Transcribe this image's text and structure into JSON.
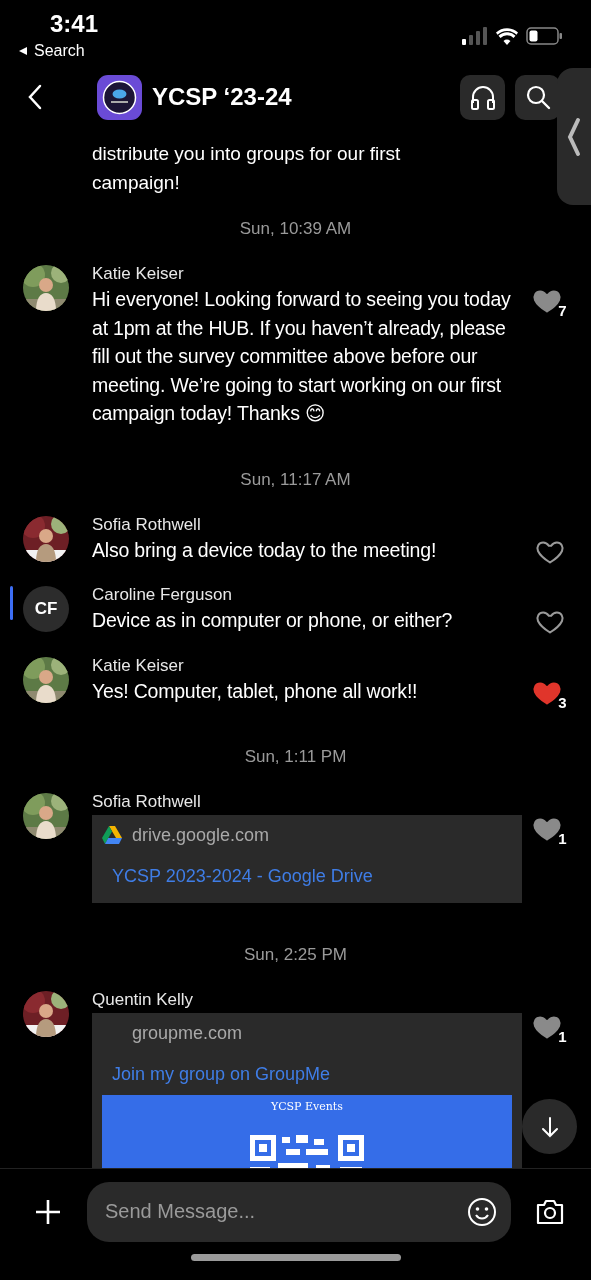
{
  "status_bar": {
    "time": "3:41",
    "back_label": "Search"
  },
  "header": {
    "title": "YCSP ‘23-24"
  },
  "feed": [
    {
      "kind": "continuation",
      "text": "distribute you into groups for our first campaign!"
    },
    {
      "kind": "time",
      "text": "Sun, 10:39 AM"
    },
    {
      "kind": "message",
      "author": "Katie Keiser",
      "text": "Hi everyone! Looking forward to seeing you today at 1pm at the HUB. If you haven’t already, please fill out the survey committee above before our meeting. We’re going to start working on our first campaign today! Thanks 😊",
      "likes": "7",
      "liked": false,
      "highlighted": false
    },
    {
      "kind": "time",
      "text": "Sun, 11:17 AM"
    },
    {
      "kind": "message",
      "author": "Sofia Rothwell",
      "text": "Also bring a device today to the meeting!",
      "liked": false,
      "highlighted": false
    },
    {
      "kind": "message",
      "author": "Caroline Ferguson",
      "initials": "CF",
      "text": "Device as in computer or phone, or either?",
      "liked": false,
      "highlighted": true
    },
    {
      "kind": "message",
      "author": "Katie Keiser",
      "text": "Yes! Computer, tablet, phone all work!!",
      "likes": "3",
      "liked": true,
      "highlighted": false
    },
    {
      "kind": "time",
      "text": "Sun, 1:11 PM"
    },
    {
      "kind": "link",
      "author": "Sofia Rothwell",
      "domain": "drive.google.com",
      "link_title": "YCSP 2023-2024 - Google Drive",
      "likes": "1",
      "liked": false,
      "highlighted": false
    },
    {
      "kind": "time",
      "text": "Sun, 2:25 PM"
    },
    {
      "kind": "link",
      "author": "Quentin Kelly",
      "domain": "groupme.com",
      "link_title": "Join my group on GroupMe",
      "preview_caption": "YCSP Events",
      "likes": "1",
      "liked": false,
      "highlighted": false
    }
  ],
  "composer": {
    "placeholder": "Send Message..."
  }
}
